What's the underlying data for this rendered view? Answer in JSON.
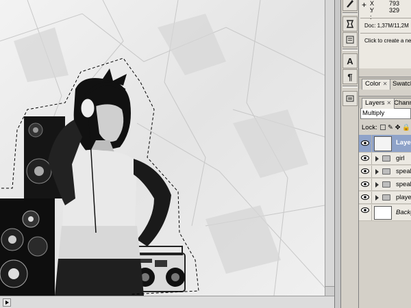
{
  "info": {
    "x_label": "X :",
    "x_value": "793",
    "y_label": "Y :",
    "y_value": "329",
    "doc": "Doc: 1,37M/11,2M",
    "hint": "Click to create a ne"
  },
  "tabs_top": {
    "color": "Color",
    "swatches": "Swatch"
  },
  "tabs_layers": {
    "layers": "Layers",
    "channels": "Chann"
  },
  "blend_mode": "Multiply",
  "lock_label": "Lock:",
  "layers": [
    {
      "name": "Layer",
      "type": "layer",
      "selected": true
    },
    {
      "name": "girl",
      "type": "group"
    },
    {
      "name": "speal",
      "type": "group"
    },
    {
      "name": "speal",
      "type": "group"
    },
    {
      "name": "playe",
      "type": "group"
    },
    {
      "name": "Backg",
      "type": "background"
    }
  ],
  "icons": {
    "toolstrip": [
      "brush-icon",
      "history-icon",
      "actions-icon",
      "character-icon",
      "paragraph-icon",
      "layer-comps-icon"
    ],
    "panel": [
      "eye-icon",
      "folder-icon",
      "lock-icon"
    ]
  }
}
